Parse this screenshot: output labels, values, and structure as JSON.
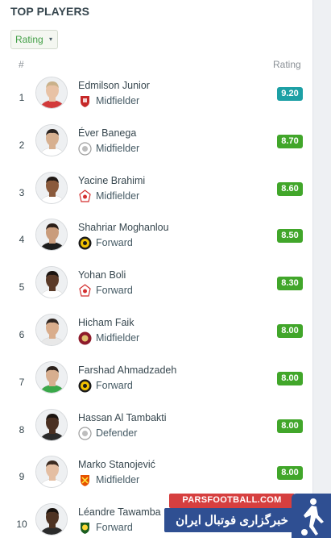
{
  "header": {
    "title": "TOP PLAYERS"
  },
  "filter": {
    "selected": "Rating",
    "caret": "▾"
  },
  "columns": {
    "rank": "#",
    "rating": "Rating"
  },
  "players": [
    {
      "rank": "1",
      "name": "Edmilson Junior",
      "position": "Midfielder",
      "rating": "9.20",
      "rating_color": "#1da0a5",
      "skin": "#e8c2a5",
      "hair": "#c9b18a",
      "shirt": "#d23a3a",
      "club_icon": "shield-red"
    },
    {
      "rank": "2",
      "name": "Éver Banega",
      "position": "Midfielder",
      "rating": "8.70",
      "rating_color": "#41a62a",
      "skin": "#d7b090",
      "hair": "#2a2320",
      "shirt": "#ffffff",
      "club_icon": "circle-grey"
    },
    {
      "rank": "3",
      "name": "Yacine Brahimi",
      "position": "Midfielder",
      "rating": "8.60",
      "rating_color": "#41a62a",
      "skin": "#8a5a3c",
      "hair": "#201814",
      "shirt": "#ffffff",
      "club_icon": "crest-red-white"
    },
    {
      "rank": "4",
      "name": "Shahriar Moghanlou",
      "position": "Forward",
      "rating": "8.50",
      "rating_color": "#41a62a",
      "skin": "#c99c7c",
      "hair": "#2a1e18",
      "shirt": "#1d1d1d",
      "club_icon": "circle-yellow-black"
    },
    {
      "rank": "5",
      "name": "Yohan Boli",
      "position": "Forward",
      "rating": "8.30",
      "rating_color": "#41a62a",
      "skin": "#5a3a28",
      "hair": "#1a1410",
      "shirt": "#ffffff",
      "club_icon": "crest-red-white"
    },
    {
      "rank": "6",
      "name": "Hicham Faik",
      "position": "Midfielder",
      "rating": "8.00",
      "rating_color": "#41a62a",
      "skin": "#d9ad8c",
      "hair": "#2f2520",
      "shirt": "#e8e8e8",
      "club_icon": "circle-maroon"
    },
    {
      "rank": "7",
      "name": "Farshad Ahmadzadeh",
      "position": "Forward",
      "rating": "8.00",
      "rating_color": "#41a62a",
      "skin": "#d7ae8f",
      "hair": "#2b211b",
      "shirt": "#3aa84a",
      "club_icon": "circle-yellow-black"
    },
    {
      "rank": "8",
      "name": "Hassan Al Tambakti",
      "position": "Defender",
      "rating": "8.00",
      "rating_color": "#41a62a",
      "skin": "#4a3022",
      "hair": "#1b1410",
      "shirt": "#2b2b2b",
      "club_icon": "circle-grey"
    },
    {
      "rank": "9",
      "name": "Marko Stanojević",
      "position": "Midfielder",
      "rating": "8.00",
      "rating_color": "#41a62a",
      "skin": "#e4bea2",
      "hair": "#3b2a20",
      "shirt": "#ffffff",
      "club_icon": "shield-orange-red"
    },
    {
      "rank": "10",
      "name": "Léandre Tawamba",
      "position": "Forward",
      "rating": "",
      "rating_color": "#41a62a",
      "skin": "#4e3323",
      "hair": "#17110d",
      "shirt": "#2b2b2b",
      "club_icon": "shield-green-yellow"
    }
  ],
  "watermark": {
    "url": "PARSFOOTBALL.COM",
    "tagline": "خبرگزاری فوتبال ایران"
  }
}
